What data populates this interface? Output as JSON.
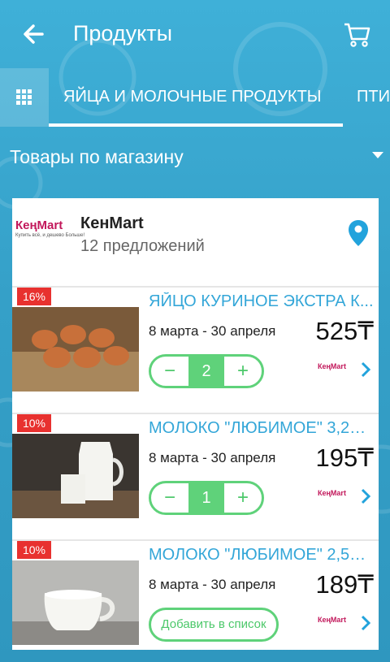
{
  "header": {
    "title": "Продукты"
  },
  "tabs": [
    {
      "label": "ЯЙЦА И МОЛОЧНЫЕ ПРОДУКТЫ"
    },
    {
      "label": "ПТИ"
    }
  ],
  "filter": {
    "label": "Товары по магазину"
  },
  "store": {
    "name": "КенMart",
    "offers": "12 предложений",
    "logo_text": "КеңMart",
    "logo_tagline": "Купить всё, и дешево Больше!"
  },
  "products": [
    {
      "discount": "16%",
      "name": "ЯЙЦО КУРИНОЕ ЭКСТРА К...",
      "date": "8 марта - 30 апреля",
      "price": "525₸",
      "quantity": "2"
    },
    {
      "discount": "10%",
      "name": "МОЛОКО \"ЛЮБИМОЕ\" 3,2%...",
      "date": "8 марта - 30 апреля",
      "price": "195₸",
      "quantity": "1"
    },
    {
      "discount": "10%",
      "name": "МОЛОКО \"ЛЮБИМОЕ\" 2,5%...",
      "date": "8 марта - 30 апреля",
      "price": "189₸",
      "add_label": "Добавить в список"
    }
  ],
  "colors": {
    "accent": "#33a6d8",
    "green": "#5fd27a",
    "badge": "#e8312f",
    "background": "#3aa3cc"
  },
  "icons": [
    "back-arrow-icon",
    "cart-icon",
    "grid-icon",
    "dropdown-arrow-icon",
    "location-pin-icon",
    "chevron-right-icon"
  ]
}
